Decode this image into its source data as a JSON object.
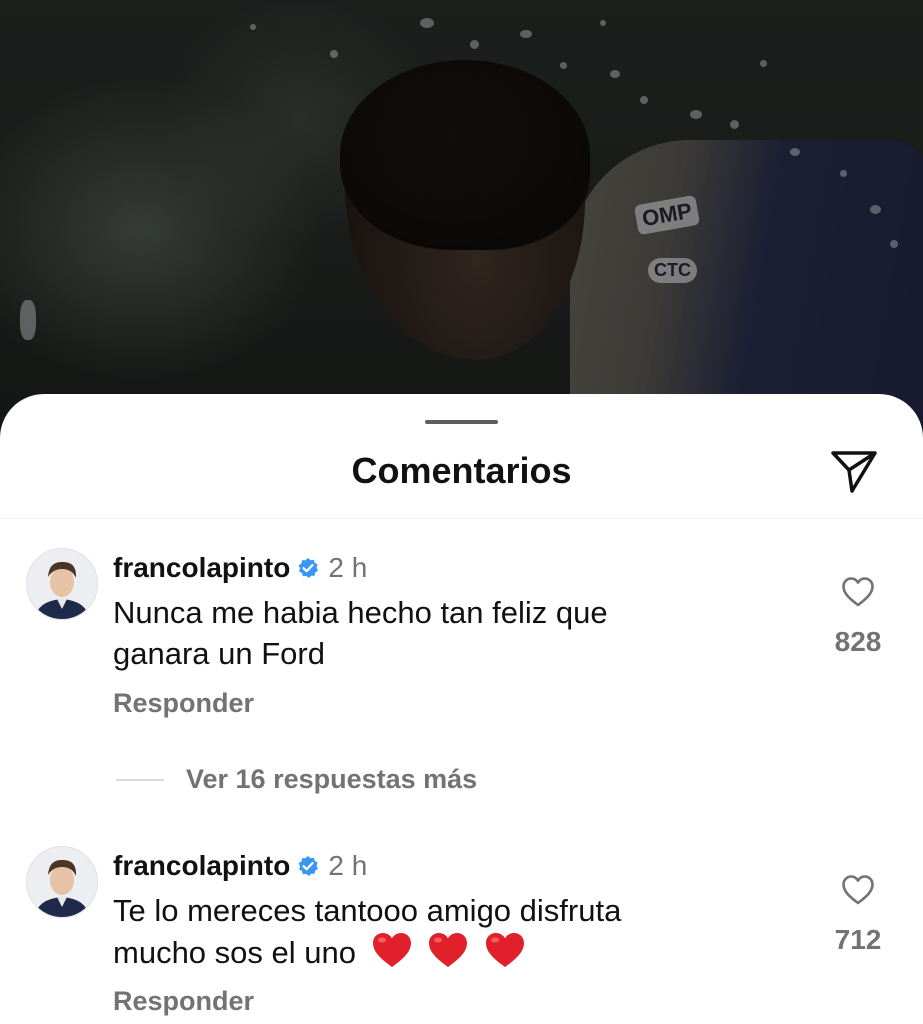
{
  "sheet": {
    "title": "Comentarios",
    "share_icon": "paper-plane-icon"
  },
  "comments": [
    {
      "username": "francolapinto",
      "verified": true,
      "time": "2 h",
      "text_line1": "Nunca me habia hecho tan feliz que",
      "text_line2": "ganara un Ford",
      "reply_label": "Responder",
      "like_icon": "heart-outline-icon",
      "like_count": "828"
    },
    {
      "username": "francolapinto",
      "verified": true,
      "time": "2 h",
      "text_line1": "Te lo mereces tantooo amigo disfruta",
      "text_line2": "mucho sos el uno",
      "emoji": [
        "red-heart",
        "red-heart",
        "red-heart"
      ],
      "reply_label": "Responder",
      "like_icon": "heart-outline-icon",
      "like_count": "712"
    }
  ],
  "view_replies_label": "Ver 16 respuestas más",
  "colors": {
    "text_primary": "#111111",
    "text_secondary": "#737373",
    "verified_blue": "#3897f0",
    "heart_red": "#e0202a"
  }
}
